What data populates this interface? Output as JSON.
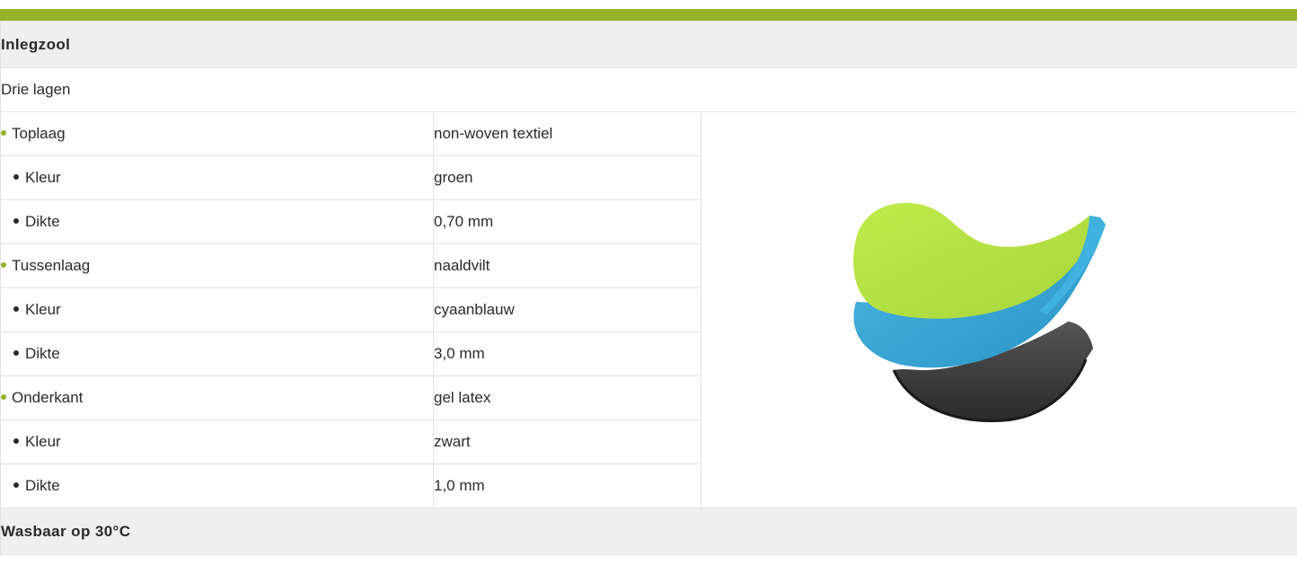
{
  "sections": {
    "insole_title": "Inlegzool",
    "intro": "Drie lagen",
    "washable": "Wasbaar op 30°C"
  },
  "rows": [
    {
      "label": "Toplaag",
      "value": "non-woven textiel",
      "level": 1
    },
    {
      "label": "Kleur",
      "value": "groen",
      "level": 2
    },
    {
      "label": "Dikte",
      "value": "0,70 mm",
      "level": 2
    },
    {
      "label": "Tussenlaag",
      "value": "naaldvilt",
      "level": 1
    },
    {
      "label": "Kleur",
      "value": "cyaanblauw",
      "level": 2
    },
    {
      "label": "Dikte",
      "value": "3,0 mm",
      "level": 2
    },
    {
      "label": "Onderkant",
      "value": "gel latex",
      "level": 1
    },
    {
      "label": "Kleur",
      "value": "zwart",
      "level": 2
    },
    {
      "label": "Dikte",
      "value": "1,0 mm",
      "level": 2
    }
  ],
  "colors": {
    "accent": "#96b32a",
    "section_bg": "#efefef",
    "layer_top": "#b6e52f",
    "layer_middle": "#38a9d6",
    "layer_bottom": "#3a3a3a"
  },
  "image": {
    "icon": "insole-layers-image"
  }
}
